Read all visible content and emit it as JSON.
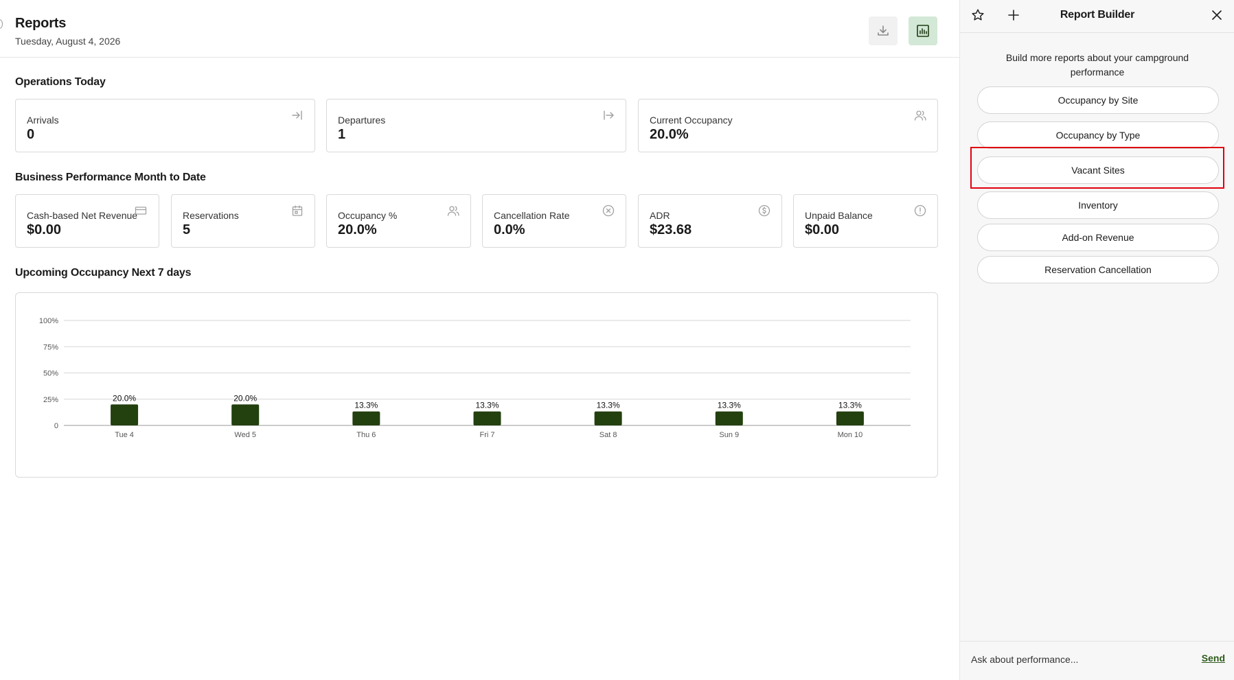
{
  "header": {
    "title": "Reports",
    "date": "Tuesday, August 4, 2026"
  },
  "operations_today": {
    "title": "Operations Today",
    "cards": [
      {
        "label": "Arrivals",
        "value": "0",
        "icon": "arrow-right-to-line-icon"
      },
      {
        "label": "Departures",
        "value": "1",
        "icon": "arrow-right-from-line-icon"
      },
      {
        "label": "Current Occupancy",
        "value": "20.0%",
        "icon": "users-icon"
      }
    ]
  },
  "business_performance": {
    "title": "Business Performance Month to Date",
    "cards": [
      {
        "label": "Cash-based Net Revenue",
        "value": "$0.00",
        "icon": "credit-card-icon"
      },
      {
        "label": "Reservations",
        "value": "5",
        "icon": "calendar-icon"
      },
      {
        "label": "Occupancy %",
        "value": "20.0%",
        "icon": "users-icon"
      },
      {
        "label": "Cancellation Rate",
        "value": "0.0%",
        "icon": "circle-x-icon"
      },
      {
        "label": "ADR",
        "value": "$23.68",
        "icon": "dollar-circle-icon"
      },
      {
        "label": "Unpaid Balance",
        "value": "$0.00",
        "icon": "alert-circle-icon"
      }
    ]
  },
  "upcoming": {
    "title": "Upcoming Occupancy Next 7 days"
  },
  "chart_data": {
    "type": "bar",
    "categories": [
      "Tue 4",
      "Wed 5",
      "Thu 6",
      "Fri 7",
      "Sat 8",
      "Sun 9",
      "Mon 10"
    ],
    "values": [
      20.0,
      20.0,
      13.3,
      13.3,
      13.3,
      13.3,
      13.3
    ],
    "data_labels": [
      "20.0%",
      "20.0%",
      "13.3%",
      "13.3%",
      "13.3%",
      "13.3%",
      "13.3%"
    ],
    "yticks": [
      "0",
      "25%",
      "50%",
      "75%",
      "100%"
    ],
    "ytick_values": [
      0,
      25,
      50,
      75,
      100
    ],
    "ylim": [
      0,
      100
    ],
    "grid": true,
    "bar_color": "#23400f"
  },
  "panel": {
    "title": "Report Builder",
    "intro": "Build more reports about your campground performance",
    "buttons": [
      "Occupancy by Site",
      "Occupancy by Type",
      "Vacant Sites",
      "Inventory",
      "Add-on Revenue",
      "Reservation Cancellation"
    ],
    "ask_placeholder": "Ask about performance...",
    "send_label": "Send"
  },
  "colors": {
    "highlight": "#e0000f",
    "accent_bg": "#d3e8d6",
    "accent": "#2d5a1b"
  }
}
